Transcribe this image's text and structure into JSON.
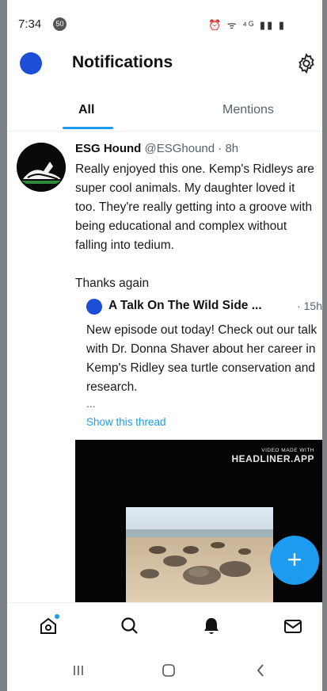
{
  "status_bar": {
    "time": "7:34",
    "notification_badge": "50",
    "icons": "⏰ ᯤ ⁴ᴳ ▮▮ ▮"
  },
  "header": {
    "title": "Notifications",
    "settings_icon": "gear-icon"
  },
  "tabs": [
    {
      "label": "All",
      "selected": true
    },
    {
      "label": "Mentions",
      "selected": false
    }
  ],
  "notification": {
    "author_name": "ESG Hound",
    "author_handle": "@ESGhound",
    "time_separator": "·",
    "time": "8h",
    "text_main": "Really enjoyed this one. Kemp's Ridleys are super cool animals. My daughter loved it too. They're really getting into a groove with being educational and complex without falling into tedium.",
    "text_thanks": "Thanks again",
    "quoted": {
      "author": "A Talk On The Wild Side ...",
      "time": "· 15h",
      "text": "New episode out today!  Check out our talk with Dr. Donna Shaver about her career in Kemp's Ridley sea turtle conservation and research.",
      "ellipsis": "...",
      "show_thread": "Show this thread"
    },
    "media": {
      "credit_small": "VIDEO MADE WITH",
      "credit_big": "HEADLINER.APP"
    }
  },
  "compose_button": {
    "label": "+"
  },
  "bottom_nav": [
    "home-icon",
    "search-icon",
    "notifications-bell-icon",
    "messages-envelope-icon"
  ],
  "colors": {
    "accent": "#1d9bf0",
    "avatar_blue": "#1d4ed8",
    "secondary_text": "#536471"
  }
}
